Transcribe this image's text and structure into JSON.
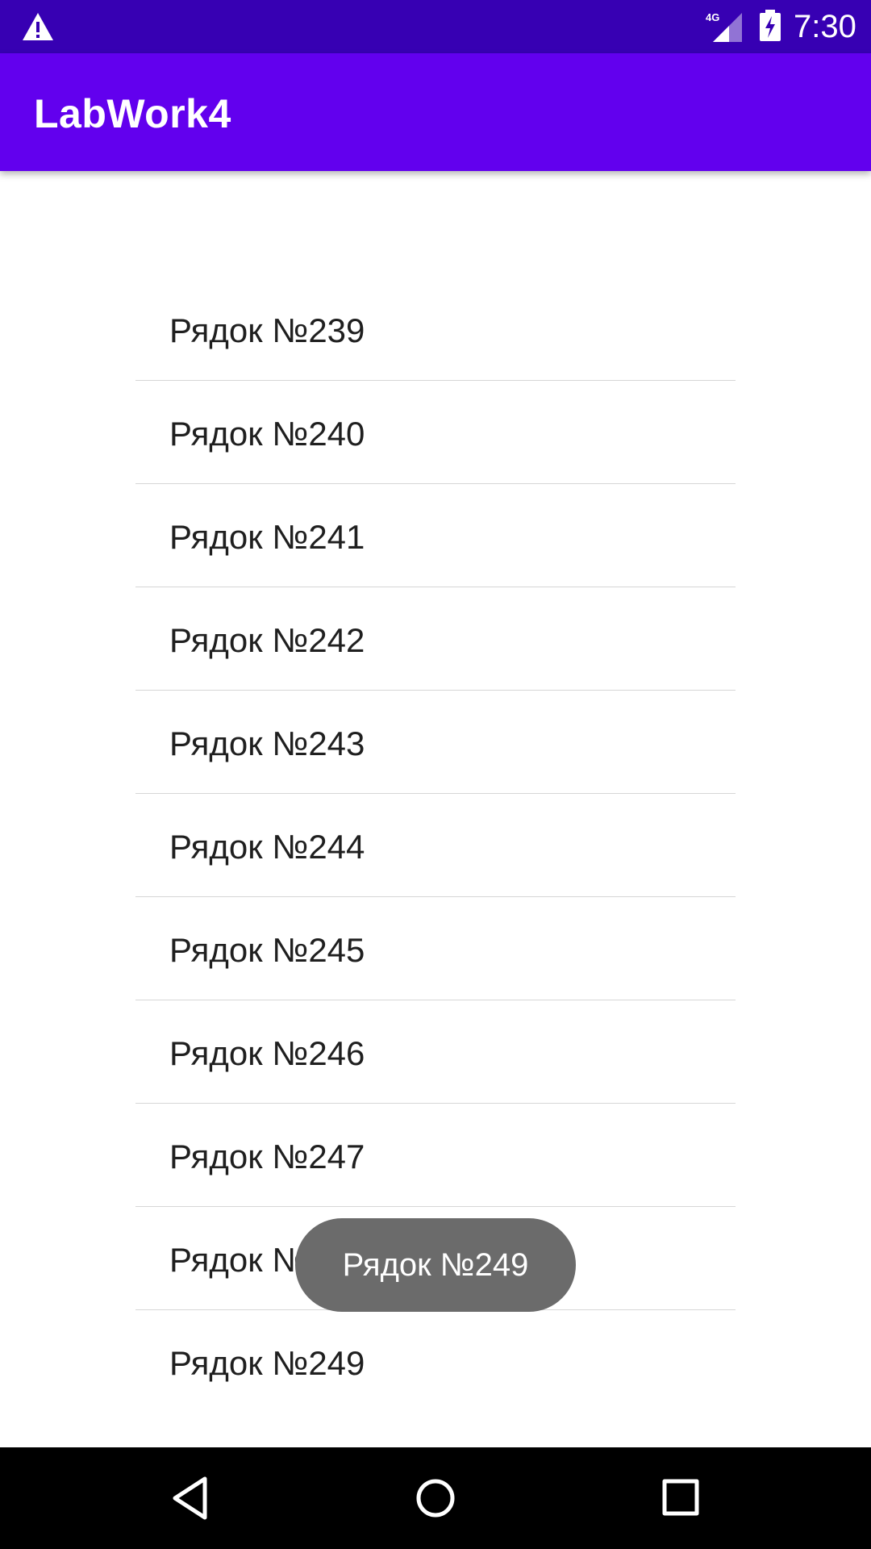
{
  "status_bar": {
    "time": "7:30",
    "network_label": "4G",
    "warning_icon": "warning-icon",
    "signal_icon": "signal-icon",
    "battery_icon": "battery-charging-icon"
  },
  "app_bar": {
    "title": "LabWork4",
    "color": "#6200ee"
  },
  "list": {
    "items": [
      {
        "label": "Рядок №239"
      },
      {
        "label": "Рядок №240"
      },
      {
        "label": "Рядок №241"
      },
      {
        "label": "Рядок №242"
      },
      {
        "label": "Рядок №243"
      },
      {
        "label": "Рядок №244"
      },
      {
        "label": "Рядок №245"
      },
      {
        "label": "Рядок №246"
      },
      {
        "label": "Рядок №247"
      },
      {
        "label": "Рядок №248"
      },
      {
        "label": "Рядок №249"
      }
    ]
  },
  "toast": {
    "text": "Рядок №249"
  },
  "nav_bar": {
    "back_icon": "back-icon",
    "home_icon": "home-icon",
    "recents_icon": "recents-icon"
  },
  "colors": {
    "status_bar": "#3700b3",
    "app_bar": "#6200ee",
    "toast": "#6b6b6b",
    "nav_bar": "#000000"
  }
}
